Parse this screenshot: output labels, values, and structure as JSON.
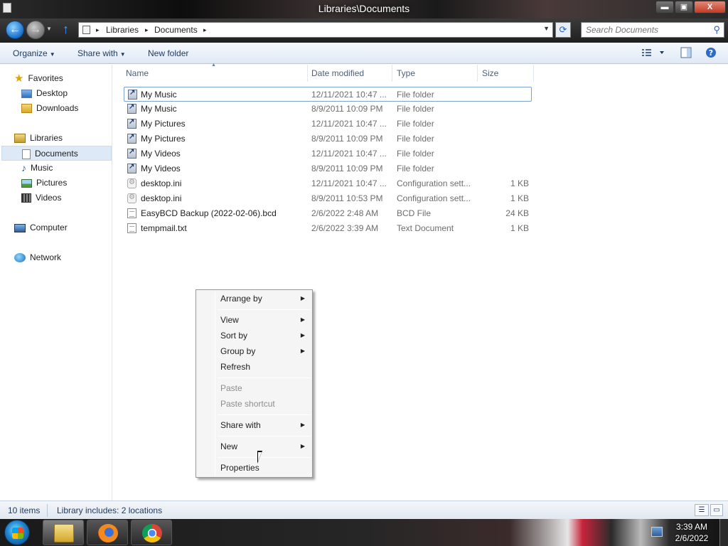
{
  "window": {
    "title": "Libraries\\Documents",
    "minimize_glyph": "▬",
    "maximize_glyph": "▣",
    "close_glyph": "X"
  },
  "address": {
    "crumbs": [
      "Libraries",
      "Documents"
    ],
    "separator": "▸",
    "search_placeholder": "Search Documents"
  },
  "commands": {
    "organize": "Organize",
    "share_with": "Share with",
    "new_folder": "New folder",
    "caret": "▼"
  },
  "nav": {
    "favorites": "Favorites",
    "desktop": "Desktop",
    "downloads": "Downloads",
    "libraries": "Libraries",
    "documents": "Documents",
    "music": "Music",
    "pictures": "Pictures",
    "videos": "Videos",
    "computer": "Computer",
    "network": "Network"
  },
  "columns": {
    "name": "Name",
    "date": "Date modified",
    "type": "Type",
    "size": "Size"
  },
  "files": [
    {
      "name": "My Music",
      "date": "12/11/2021 10:47 ...",
      "type": "File folder",
      "size": "",
      "icon": "shortcut-folder"
    },
    {
      "name": "My Music",
      "date": "8/9/2011 10:09 PM",
      "type": "File folder",
      "size": "",
      "icon": "shortcut-folder"
    },
    {
      "name": "My Pictures",
      "date": "12/11/2021 10:47 ...",
      "type": "File folder",
      "size": "",
      "icon": "shortcut-folder"
    },
    {
      "name": "My Pictures",
      "date": "8/9/2011 10:09 PM",
      "type": "File folder",
      "size": "",
      "icon": "shortcut-folder"
    },
    {
      "name": "My Videos",
      "date": "12/11/2021 10:47 ...",
      "type": "File folder",
      "size": "",
      "icon": "shortcut-folder"
    },
    {
      "name": "My Videos",
      "date": "8/9/2011 10:09 PM",
      "type": "File folder",
      "size": "",
      "icon": "shortcut-folder"
    },
    {
      "name": "desktop.ini",
      "date": "12/11/2021 10:47 ...",
      "type": "Configuration sett...",
      "size": "1 KB",
      "icon": "settings-file"
    },
    {
      "name": "desktop.ini",
      "date": "8/9/2011 10:53 PM",
      "type": "Configuration sett...",
      "size": "1 KB",
      "icon": "settings-file"
    },
    {
      "name": "EasyBCD Backup (2022-02-06).bcd",
      "date": "2/6/2022 2:48 AM",
      "type": "BCD File",
      "size": "24 KB",
      "icon": "document-file"
    },
    {
      "name": "tempmail.txt",
      "date": "2/6/2022 3:39 AM",
      "type": "Text Document",
      "size": "1 KB",
      "icon": "text-file"
    }
  ],
  "context_menu": {
    "arrange_by": "Arrange by",
    "view": "View",
    "sort_by": "Sort by",
    "group_by": "Group by",
    "refresh": "Refresh",
    "paste": "Paste",
    "paste_shortcut": "Paste shortcut",
    "share_with": "Share with",
    "new": "New",
    "properties": "Properties",
    "submenu_arrow": "▶"
  },
  "status": {
    "items": "10 items",
    "library": "Library includes: 2 locations"
  },
  "taskbar": {
    "time": "3:39 AM",
    "date": "2/6/2022",
    "apps": [
      "Windows Explorer",
      "Firefox",
      "Google Chrome"
    ]
  }
}
